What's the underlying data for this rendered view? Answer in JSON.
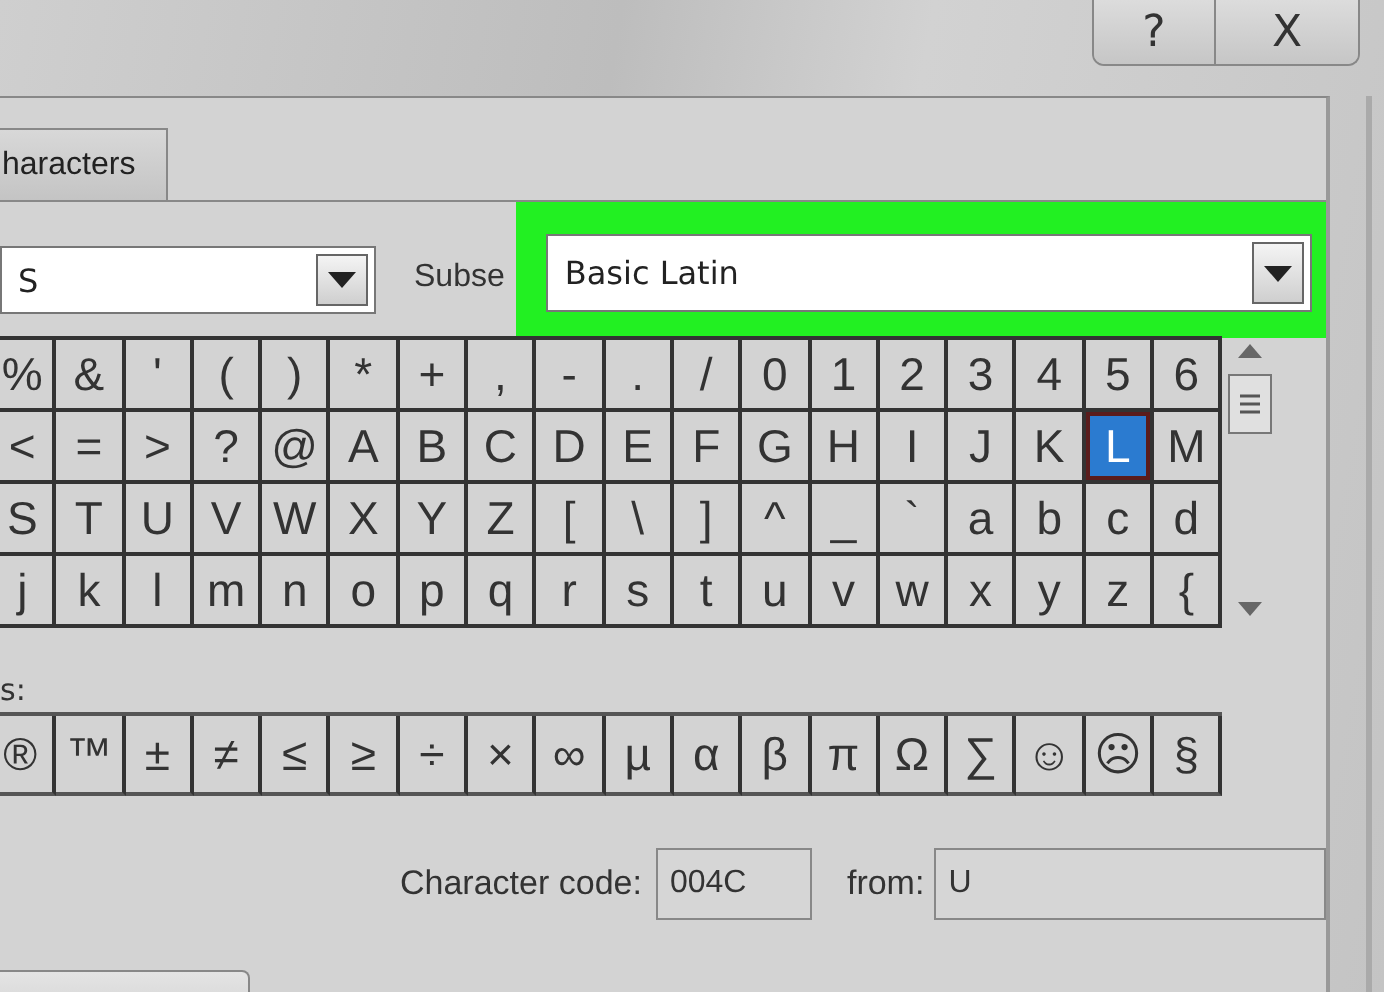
{
  "title_bar": {
    "buttons": [
      {
        "kind": "help",
        "label": "?"
      },
      {
        "kind": "close",
        "label": "X"
      }
    ]
  },
  "tabs": [
    {
      "label": "haracters",
      "selected": false
    }
  ],
  "font": {
    "value": "S"
  },
  "subset": {
    "label": "Subse",
    "value": "Basic Latin",
    "highlighted": true
  },
  "symbols": [
    {
      "char": "%",
      "selected": false
    },
    {
      "char": "&",
      "selected": false
    },
    {
      "char": "'",
      "selected": false
    },
    {
      "char": "(",
      "selected": false
    },
    {
      "char": ")",
      "selected": false
    },
    {
      "char": "*",
      "selected": false
    },
    {
      "char": "+",
      "selected": false
    },
    {
      "char": ",",
      "selected": false
    },
    {
      "char": "-",
      "selected": false
    },
    {
      "char": ".",
      "selected": false
    },
    {
      "char": "/",
      "selected": false
    },
    {
      "char": "0",
      "selected": false
    },
    {
      "char": "1",
      "selected": false
    },
    {
      "char": "2",
      "selected": false
    },
    {
      "char": "3",
      "selected": false
    },
    {
      "char": "4",
      "selected": false
    },
    {
      "char": "5",
      "selected": false
    },
    {
      "char": "6",
      "selected": false
    },
    {
      "char": "<",
      "selected": false
    },
    {
      "char": "=",
      "selected": false
    },
    {
      "char": ">",
      "selected": false
    },
    {
      "char": "?",
      "selected": false
    },
    {
      "char": "@",
      "selected": false
    },
    {
      "char": "A",
      "selected": false
    },
    {
      "char": "B",
      "selected": false
    },
    {
      "char": "C",
      "selected": false
    },
    {
      "char": "D",
      "selected": false
    },
    {
      "char": "E",
      "selected": false
    },
    {
      "char": "F",
      "selected": false
    },
    {
      "char": "G",
      "selected": false
    },
    {
      "char": "H",
      "selected": false
    },
    {
      "char": "I",
      "selected": false
    },
    {
      "char": "J",
      "selected": false
    },
    {
      "char": "K",
      "selected": false
    },
    {
      "char": "L",
      "selected": true
    },
    {
      "char": "M",
      "selected": false
    },
    {
      "char": "S",
      "selected": false
    },
    {
      "char": "T",
      "selected": false
    },
    {
      "char": "U",
      "selected": false
    },
    {
      "char": "V",
      "selected": false
    },
    {
      "char": "W",
      "selected": false
    },
    {
      "char": "X",
      "selected": false
    },
    {
      "char": "Y",
      "selected": false
    },
    {
      "char": "Z",
      "selected": false
    },
    {
      "char": "[",
      "selected": false
    },
    {
      "char": "\\",
      "selected": false
    },
    {
      "char": "]",
      "selected": false
    },
    {
      "char": "^",
      "selected": false
    },
    {
      "char": "_",
      "selected": false
    },
    {
      "char": "`",
      "selected": false
    },
    {
      "char": "a",
      "selected": false
    },
    {
      "char": "b",
      "selected": false
    },
    {
      "char": "c",
      "selected": false
    },
    {
      "char": "d",
      "selected": false
    },
    {
      "char": "j",
      "selected": false
    },
    {
      "char": "k",
      "selected": false
    },
    {
      "char": "l",
      "selected": false
    },
    {
      "char": "m",
      "selected": false
    },
    {
      "char": "n",
      "selected": false
    },
    {
      "char": "o",
      "selected": false
    },
    {
      "char": "p",
      "selected": false
    },
    {
      "char": "q",
      "selected": false
    },
    {
      "char": "r",
      "selected": false
    },
    {
      "char": "s",
      "selected": false
    },
    {
      "char": "t",
      "selected": false
    },
    {
      "char": "u",
      "selected": false
    },
    {
      "char": "v",
      "selected": false
    },
    {
      "char": "w",
      "selected": false
    },
    {
      "char": "x",
      "selected": false
    },
    {
      "char": "y",
      "selected": false
    },
    {
      "char": "z",
      "selected": false
    },
    {
      "char": "{",
      "selected": false
    }
  ],
  "recent_label": "s:",
  "recent": [
    "®",
    "™",
    "±",
    "≠",
    "≤",
    "≥",
    "÷",
    "×",
    "∞",
    "µ",
    "α",
    "β",
    "π",
    "Ω",
    "∑",
    "☺",
    "☹",
    "§"
  ],
  "character_code": {
    "label": "Character code:",
    "value": "004C"
  },
  "from": {
    "label": "from:",
    "value": "U"
  }
}
